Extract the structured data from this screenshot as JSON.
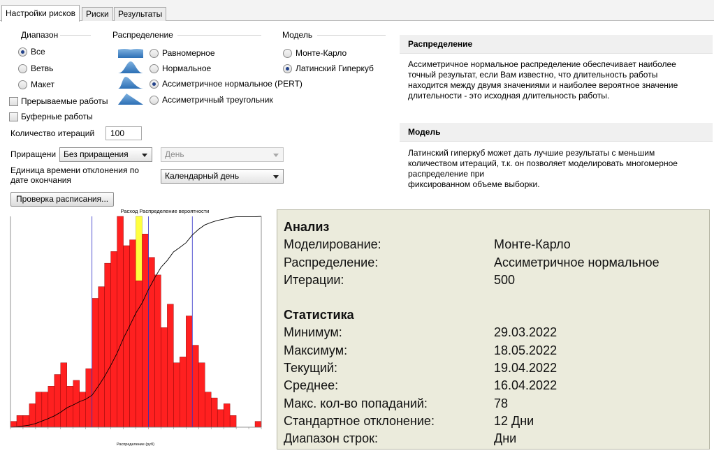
{
  "tabs": [
    {
      "label": "Настройки рисков",
      "active": true
    },
    {
      "label": "Риски",
      "active": false
    },
    {
      "label": "Результаты",
      "active": false
    }
  ],
  "range": {
    "title": "Диапазон",
    "options": [
      {
        "label": "Все",
        "selected": true
      },
      {
        "label": "Ветвь",
        "selected": false
      },
      {
        "label": "Макет",
        "selected": false
      }
    ]
  },
  "distribution": {
    "title": "Распределение",
    "options": [
      {
        "label": "Равномерное",
        "icon": "uniform-distribution-icon",
        "selected": false
      },
      {
        "label": "Нормальное",
        "icon": "normal-distribution-icon",
        "selected": false
      },
      {
        "label": "Ассиметричное нормальное (PERT)",
        "icon": "pert-distribution-icon",
        "selected": true
      },
      {
        "label": "Ассиметричный треугольник",
        "icon": "triangle-distribution-icon",
        "selected": false
      }
    ]
  },
  "model": {
    "title": "Модель",
    "options": [
      {
        "label": "Монте-Карло",
        "selected": false
      },
      {
        "label": "Латинский Гиперкуб",
        "selected": true
      }
    ]
  },
  "checkboxes": [
    {
      "label": "Прерываемые работы",
      "checked": false
    },
    {
      "label": "Буферные работы",
      "checked": false
    }
  ],
  "iterations": {
    "label": "Количество итераций",
    "value": "100"
  },
  "increment": {
    "label": "Приращени",
    "value": "Без приращения",
    "unit_value": "День"
  },
  "deviation": {
    "label_line1": "Единица времени отклонения по",
    "label_line2": "дате окончания",
    "value": "Календарный день"
  },
  "check_schedule_button": "Проверка расписания...",
  "info_panels": [
    {
      "title": "Распределение",
      "text": "Ассиметричное нормальное распределение обеспечивает наиболее\nточный результат, если Вам известно, что длительность работы\nнаходится между двумя значениями и наиболее вероятное значение\nдлительности - это исходная длительность работы."
    },
    {
      "title": "Модель",
      "text": "Латинский гиперкуб может дать лучшие результаты с меньшим\nколичеством итераций, т.к. он позволяет моделировать многомерное\nраспределение при\nфиксированном объеме выборки."
    }
  ],
  "analysis": {
    "section1_title": "Анализ",
    "section1_rows": [
      {
        "label": "Моделирование:",
        "value": "Монте-Карло"
      },
      {
        "label": "Распределение:",
        "value": "Ассиметричное нормальное"
      },
      {
        "label": "Итерации:",
        "value": "500"
      }
    ],
    "section2_title": "Статистика",
    "section2_rows": [
      {
        "label": "Минимум:",
        "value": "29.03.2022"
      },
      {
        "label": "Максимум:",
        "value": "18.05.2022"
      },
      {
        "label": "Текущий:",
        "value": "19.04.2022"
      },
      {
        "label": "Среднее:",
        "value": "16.04.2022"
      },
      {
        "label": "Макс. кол-во попаданий:",
        "value": "78"
      },
      {
        "label": "Стандартное отклонение:",
        "value": "12 Дни"
      },
      {
        "label": "Диапазон строк:",
        "value": "Дни"
      }
    ]
  },
  "colors": {
    "bar": "#ff2020",
    "bar_highlight": "#ffff40",
    "marker_line": "#3232c8",
    "cumulative_line": "#000000",
    "analysis_bg": "#ebebdc"
  },
  "chart_data": {
    "type": "bar",
    "title": "Расход Распределение вероятности",
    "xlabel": "Распределение (руб)",
    "values": [
      1,
      2,
      2,
      4,
      6,
      6,
      7,
      9,
      11,
      7,
      8,
      6,
      10,
      22,
      24,
      28,
      30,
      36,
      31,
      32,
      25,
      33,
      29,
      26,
      17,
      21,
      11,
      12,
      19,
      14,
      11,
      6,
      5,
      3,
      4,
      2,
      0,
      0,
      0,
      1
    ],
    "highlight_index": 20,
    "highlight_value": 36,
    "ylim": [
      0,
      36
    ],
    "cumulative_ylim": [
      0,
      100
    ],
    "marker_indices": [
      13,
      22,
      29
    ]
  }
}
